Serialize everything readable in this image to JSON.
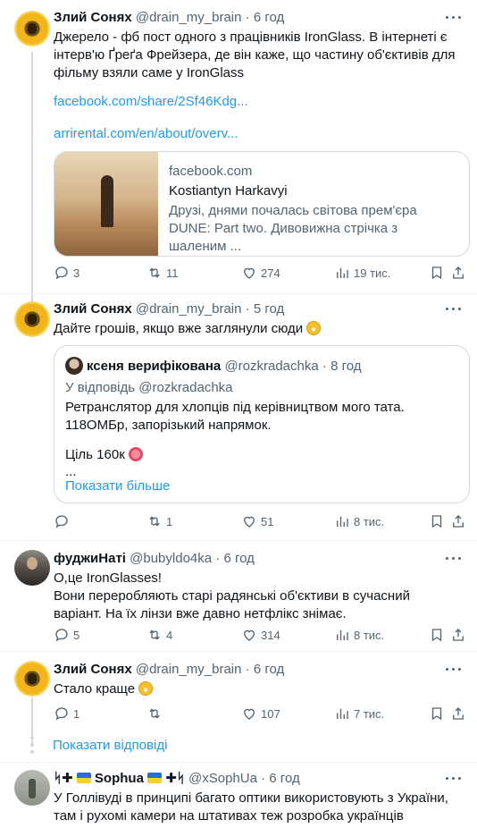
{
  "tweets": [
    {
      "name": "Злий Сонях",
      "handle": "@drain_my_brain",
      "dot": " · ",
      "time": "6 год",
      "text": "Джерело - фб пост одного з працівників IronGlass. В інтернеті є інтерв'ю Ґреґа Фрейзера, де він каже, що частину об'єктивів для фільму взяли саме у IronGlass",
      "link1": "facebook.com/share/2Sf46Kdg...",
      "link2": "arrirental.com/en/about/overv...",
      "card": {
        "domain": "facebook.com",
        "title": "Kostiantyn Harkavyi",
        "desc": "Друзі, днями почалась світова прем'єра DUNE: Part two. Дивовижна стрічка з шаленим ..."
      },
      "replies": "3",
      "retweets": "11",
      "likes": "274",
      "views": "19 тис."
    },
    {
      "name": "Злий Сонях",
      "handle": "@drain_my_brain",
      "dot": " · ",
      "time": "5 год",
      "text": "Дайте грошів, якщо вже заглянули сюди ",
      "quote": {
        "name": "ксеня верифікована",
        "handle": "@rozkradachka",
        "dot": " · ",
        "time": "8 год",
        "reply_to": "У відповідь @rozkradachka",
        "text": "Ретранслятор для хлопців під керівництвом мого тата.\n118ОМБр, запорізький напрямок.",
        "goal": "Ціль 160к ",
        "ellipsis": "...",
        "show_more": "Показати більше"
      },
      "replies": "",
      "retweets": "1",
      "likes": "51",
      "views": "8 тис."
    },
    {
      "name": "фуджиНаті",
      "handle": "@bubyldo4ka",
      "dot": " · ",
      "time": "6 год",
      "text": "О,це IronGlasses!\nВони переробляють старі радянські об'єктиви в сучасний варіант. На їх лінзи вже давно нетфлікс знімає.",
      "replies": "5",
      "retweets": "4",
      "likes": "314",
      "views": "8 тис."
    },
    {
      "name": "Злий Сонях",
      "handle": "@drain_my_brain",
      "dot": " · ",
      "time": "6 год",
      "text": "Стало краще ",
      "replies": "1",
      "retweets": "",
      "likes": "107",
      "views": "7 тис."
    },
    {
      "name_prefix": "ᛋ✚ ",
      "name": "Sophua",
      "name_suffix": " ✚ᛋ",
      "handle": "@xSophUa",
      "dot": " · ",
      "time": "6 год",
      "text": "У Голлівуді в принципі багато оптики використовують з України, там і рухомі камери на штативах теж розробка українців"
    }
  ],
  "show_replies": "Показати відповіді",
  "colors": {
    "link": "#1d9bf0",
    "secondary": "#536471",
    "border": "#cfd9de"
  }
}
